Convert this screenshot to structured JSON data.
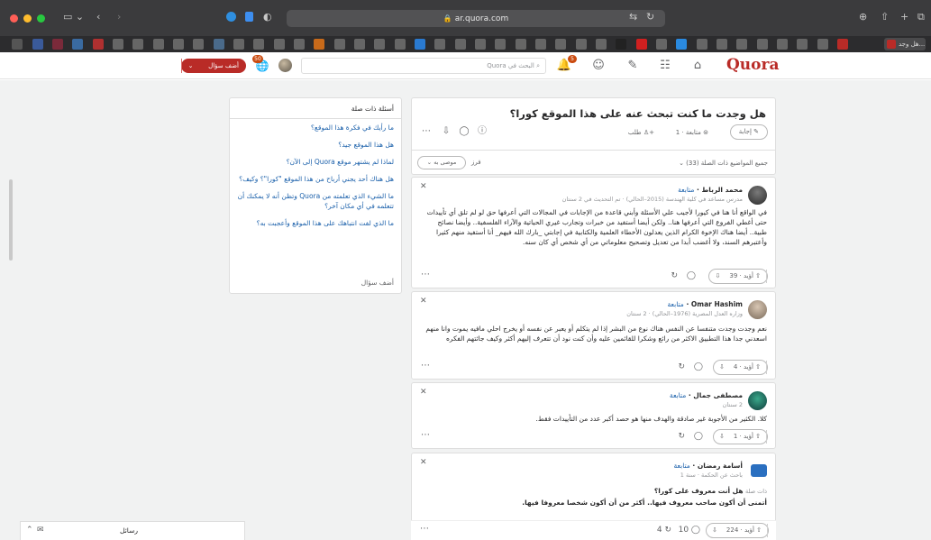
{
  "browser": {
    "url": "ar.quora.com",
    "active_tab_label": "هل وجد..."
  },
  "header": {
    "logo": "Quora",
    "search_placeholder": "البحث في Quora",
    "notification_count": "5",
    "language_badge": "50",
    "add_question_label": "أضف سؤال"
  },
  "question": {
    "title": "هل وجدت ما كنت تبحث عنه على هذا الموقع كورا؟",
    "answer_label": "إجابة",
    "follow_label": "متابعة · 1",
    "request_label": "طلب",
    "topics_label": "جميع المواضيع ذات الصلة (33)",
    "sort_label": "فرز",
    "sort_value": "موصى به"
  },
  "related": {
    "title": "أسئلة ذات صلة",
    "items": [
      "ما رأيك في فكرة هذا الموقع؟",
      "هل هذا الموقع جيد؟",
      "لماذا لم يشتهر موقع Quora إلى الآن؟",
      "هل هناك أحد يجني أرباح من هذا الموقع \"كورا\"؟ وكيف؟",
      "ما الشيء الذي تعلمته من Quora وتظن أنه لا يمكنك أن تتعلمه في أي مكان آخر؟",
      "ما الذي لفت انتباهك على هذا الموقع وأعجبت به؟"
    ],
    "add_question": "أضف سؤال"
  },
  "answers": [
    {
      "author": "محمد الرباط",
      "follow": "متابعة",
      "credential": "مدرس مساعد في كلية الهندسة (2015–الحالي) · تم التحديث في 2 سنتان",
      "body": "في الواقع أنا هنا في كيورا لأجيب علي الأسئلة وأبني قاعدة من الإجابات في المجالات التي أعرفها حق لو لم تلق أي تأييدات حتى أغطي الفروع التي أعرفها هنا.. ولكن أيضا أستفيد من خبرات وتجارب غيري الحياتية والآراء الفلسفية.. وأيضا نصائح طبية.. أيضا هناك الإخوة الكرام الذين يعدلون الأخطاء العلمية والكتابية في إجابتي _بارك الله فيهم_ أنا أستفيد منهم كثيرا وأعتبرهم السند، ولا أغضب أبدا من تعديل وتصحيح معلوماتي من أي شخص أي كان سنه.",
      "upvotes": "أؤيد · 39",
      "comments": "",
      "shares": ""
    },
    {
      "author": "Omar Hashim",
      "follow": "متابعة",
      "credential": "وزاره العدل المصرية (1976–الحالي) · 2 سنتان",
      "body": "نعم وجدت وجدت متنفسا عن النفس هناك نوع من البشر إذا لم يتكلم أو يعبر عن نفسه أو يخرج احلي مافيه يموت وانا منهم اسعدني جدا هذا التطبيق الاكثر من رائع وشكرا للقائمين عليه وأن كنت نود أن تتعرف إليهم أكثر وكيف جائتهم الفكره",
      "upvotes": "أؤيد · 4",
      "comments": "",
      "shares": ""
    },
    {
      "author": "مصطفى جمال",
      "follow": "متابعة",
      "credential": "2 سنتان",
      "body": "كلا. الكثير من الأجوبة غير صادقة والهدف منها هو حصد أكبر عدد من التأييدات فقط.",
      "upvotes": "أؤيد · 1",
      "comments": "",
      "shares": ""
    },
    {
      "author": "أسامة رمضان",
      "follow": "متابعة",
      "credential": "باحث عن الحكمة · سنة 1",
      "related_prefix": "ذات صلة",
      "related_question": "هل أنت معروف على كورا؟",
      "body": "أتمنى أن أكون صاحب معروف فيها.. أكثر من أن أكون شخصا معروفا فيها.",
      "upvotes": "أؤيد · 224",
      "comments": "10",
      "shares": "4"
    }
  ],
  "dock": {
    "messages_label": "رسائل"
  }
}
